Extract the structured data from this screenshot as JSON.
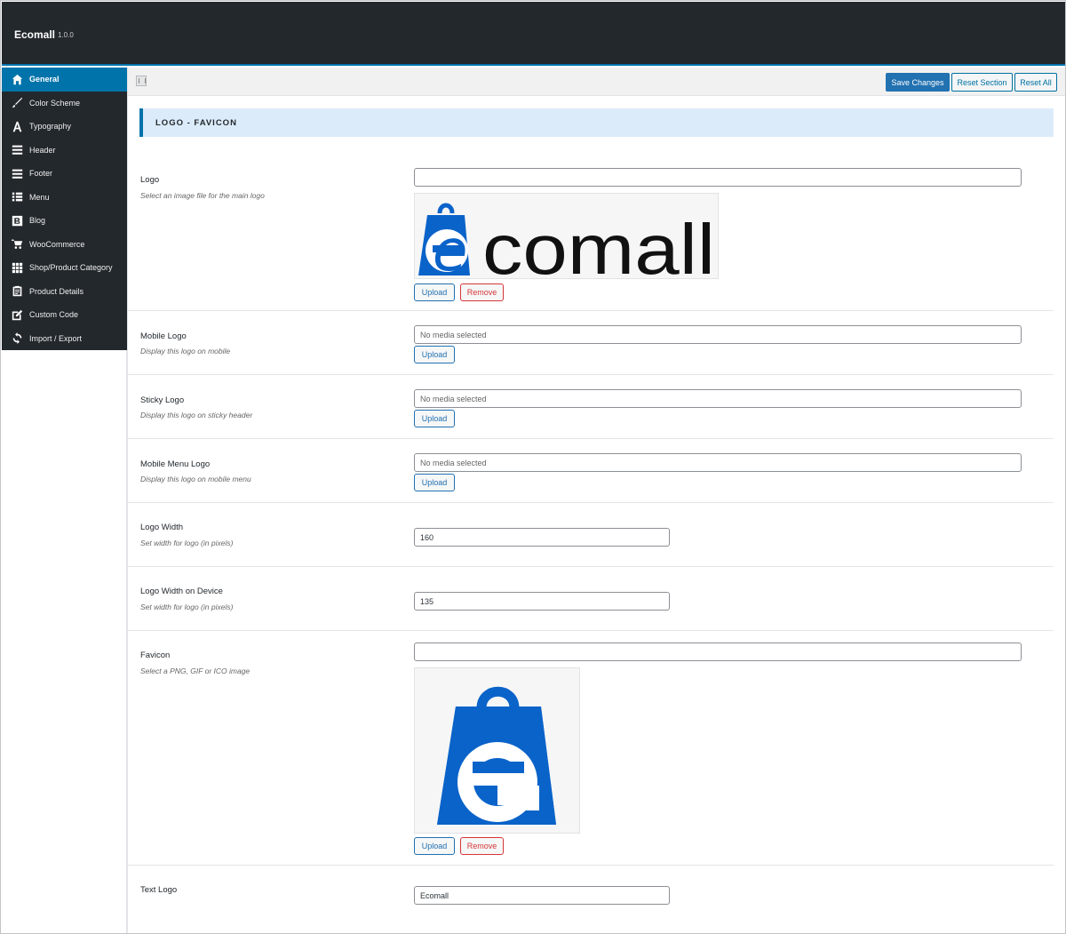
{
  "app": {
    "title": "Ecomall",
    "version": "1.0.0"
  },
  "sidebar": {
    "items": [
      {
        "label": "General",
        "icon": "home-icon",
        "active": true
      },
      {
        "label": "Color Scheme",
        "icon": "brush-icon"
      },
      {
        "label": "Typography",
        "icon": "typography-icon"
      },
      {
        "label": "Header",
        "icon": "menu-lines-icon"
      },
      {
        "label": "Footer",
        "icon": "menu-lines-icon"
      },
      {
        "label": "Menu",
        "icon": "list-icon"
      },
      {
        "label": "Blog",
        "icon": "blog-icon"
      },
      {
        "label": "WooCommerce",
        "icon": "cart-icon"
      },
      {
        "label": "Shop/Product Category",
        "icon": "grid-icon"
      },
      {
        "label": "Product Details",
        "icon": "clipboard-icon"
      },
      {
        "label": "Custom Code",
        "icon": "edit-icon"
      },
      {
        "label": "Import / Export",
        "icon": "refresh-icon"
      }
    ]
  },
  "toolbar": {
    "save_label": "Save Changes",
    "reset_section_label": "Reset Section",
    "reset_all_label": "Reset All"
  },
  "section": {
    "title": "LOGO - FAVICON"
  },
  "fields": {
    "logo": {
      "label": "Logo",
      "desc": "Select an image file for the main logo",
      "value": "",
      "logo_text": "comall",
      "logo_letter": "e"
    },
    "mobile_logo": {
      "label": "Mobile Logo",
      "desc": "Display this logo on mobile",
      "placeholder": "No media selected"
    },
    "sticky_logo": {
      "label": "Sticky Logo",
      "desc": "Display this logo on sticky header",
      "placeholder": "No media selected"
    },
    "mobile_menu_logo": {
      "label": "Mobile Menu Logo",
      "desc": "Display this logo on mobile menu",
      "placeholder": "No media selected"
    },
    "logo_width": {
      "label": "Logo Width",
      "desc": "Set width for logo (in pixels)",
      "value": "160"
    },
    "logo_width_device": {
      "label": "Logo Width on Device",
      "desc": "Set width for logo (in pixels)",
      "value": "135"
    },
    "favicon": {
      "label": "Favicon",
      "desc": "Select a PNG, GIF or ICO image",
      "value": ""
    },
    "text_logo": {
      "label": "Text Logo",
      "value": "Ecomall"
    }
  },
  "buttons": {
    "upload": "Upload",
    "remove": "Remove"
  },
  "colors": {
    "brand_blue": "#0a63c9",
    "accent": "#0073aa",
    "header_bg": "#23282d"
  }
}
